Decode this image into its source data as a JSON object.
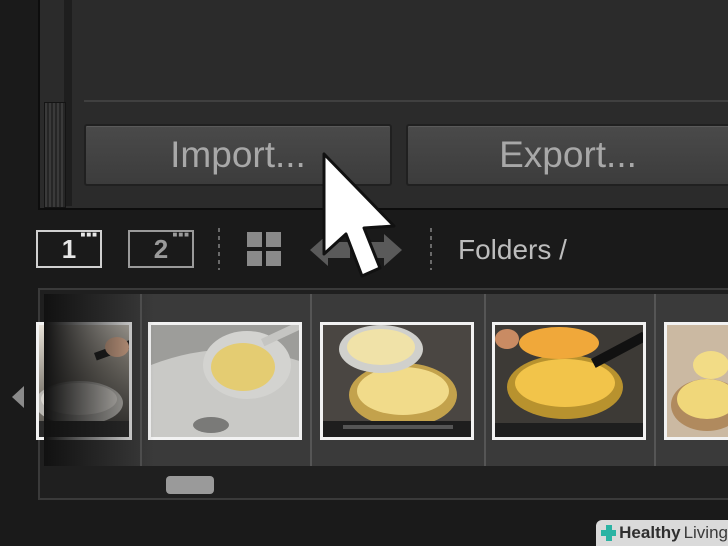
{
  "panel": {
    "import_label": "Import...",
    "export_label": "Export..."
  },
  "toolbar": {
    "view1_label": "1",
    "view2_label": "2",
    "grid_icon": "grid-icon",
    "nav_arrows_icon": "nav-arrows-icon",
    "path_label": "Folders /"
  },
  "filmstrip": {
    "thumbnails": [
      {
        "subject": "pan-with-spoon"
      },
      {
        "subject": "draining-pasta-in-sink"
      },
      {
        "subject": "pouring-pasta-into-pot"
      },
      {
        "subject": "stirring-pasta-in-pot"
      },
      {
        "subject": "pasta-in-bowl"
      }
    ],
    "left_arrow_icon": "left-arrow-icon"
  },
  "watermark": {
    "word1": "Healthy",
    "word2": "Living"
  },
  "colors": {
    "background": "#1a1a1a",
    "panel": "#2b2b2b",
    "button": "#444444",
    "button_text": "#a8a8a8",
    "filmstrip_cell": "#3a3a3a"
  }
}
